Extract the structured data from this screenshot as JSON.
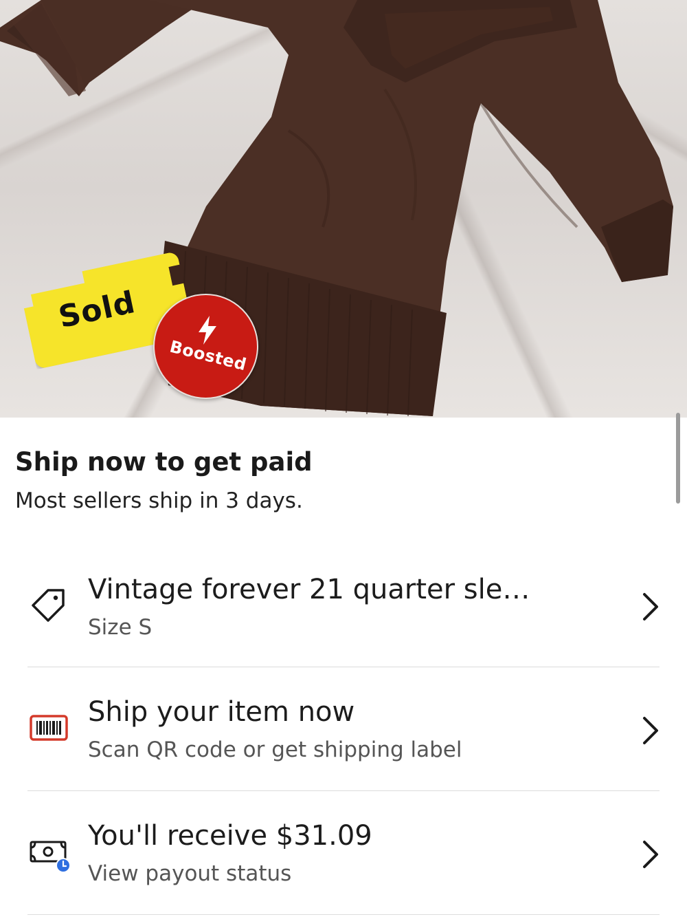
{
  "listing_photo": {
    "sold_label": "Sold",
    "boosted_label": "Boosted",
    "colors": {
      "sold_tag": "#f6e42a",
      "boosted_badge": "#c81b14",
      "garment": "#4b2f25"
    }
  },
  "header": {
    "title": "Ship now to get paid",
    "subtitle": "Most sellers ship in 3 days."
  },
  "rows": [
    {
      "icon": "price-tag-icon",
      "title": "Vintage forever 21 quarter sle…",
      "subtitle": "Size S"
    },
    {
      "icon": "barcode-icon",
      "title": "Ship your item now",
      "subtitle": "Scan QR code or get shipping label"
    },
    {
      "icon": "money-clock-icon",
      "title": "You'll receive $31.09",
      "subtitle": "View payout status"
    }
  ],
  "colors": {
    "barcode_icon": "#d43a2a",
    "clock_badge": "#2f6fe0"
  }
}
